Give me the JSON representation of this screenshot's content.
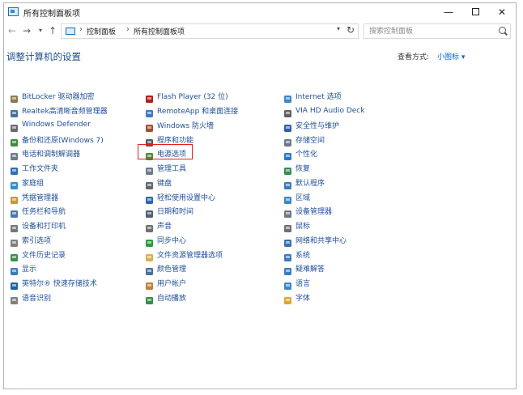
{
  "window": {
    "title": "所有控制面板项"
  },
  "address": {
    "crumbs": [
      "控制面板",
      "所有控制面板项"
    ]
  },
  "search": {
    "placeholder": "搜索控制面板"
  },
  "header": {
    "title": "调整计算机的设置",
    "view_by_label": "查看方式:",
    "view_by_value": "小图标 ▾"
  },
  "columns": [
    [
      {
        "label": "BitLocker 驱动器加密",
        "icon": "bitlocker-icon",
        "color": "#8a7a55"
      },
      {
        "label": "Realtek高清晰音频管理器",
        "icon": "realtek-icon",
        "color": "#4a6fa0"
      },
      {
        "label": "Windows Defender",
        "icon": "defender-icon",
        "color": "#6b6b6b"
      },
      {
        "label": "备份和还原(Windows 7)",
        "icon": "backup-icon",
        "color": "#3f8a3f"
      },
      {
        "label": "电话和调制解调器",
        "icon": "phone-modem-icon",
        "color": "#6b7b8b"
      },
      {
        "label": "工作文件夹",
        "icon": "work-folders-icon",
        "color": "#2f6fb5"
      },
      {
        "label": "家庭组",
        "icon": "homegroup-icon",
        "color": "#2f8fd0"
      },
      {
        "label": "凭据管理器",
        "icon": "credential-manager-icon",
        "color": "#c8963c"
      },
      {
        "label": "任务栏和导航",
        "icon": "taskbar-icon",
        "color": "#4a78b0"
      },
      {
        "label": "设备和打印机",
        "icon": "printer-icon",
        "color": "#707880"
      },
      {
        "label": "索引选项",
        "icon": "indexing-icon",
        "color": "#808080"
      },
      {
        "label": "文件历史记录",
        "icon": "file-history-icon",
        "color": "#3e8e4e"
      },
      {
        "label": "显示",
        "icon": "display-icon",
        "color": "#3a7cc0"
      },
      {
        "label": "英特尔® 快速存储技术",
        "icon": "intel-rst-icon",
        "color": "#2060a8"
      },
      {
        "label": "语音识别",
        "icon": "microphone-icon",
        "color": "#808080"
      }
    ],
    [
      {
        "label": "Flash Player (32 位)",
        "icon": "flash-icon",
        "color": "#b02020"
      },
      {
        "label": "RemoteApp 和桌面连接",
        "icon": "remoteapp-icon",
        "color": "#3a7cc0"
      },
      {
        "label": "Windows 防火墙",
        "icon": "firewall-icon",
        "color": "#a05030"
      },
      {
        "label": "程序和功能",
        "icon": "programs-icon",
        "color": "#505860"
      },
      {
        "label": "电源选项",
        "icon": "power-options-icon",
        "color": "#4a8a3a"
      },
      {
        "label": "管理工具",
        "icon": "admin-tools-icon",
        "color": "#6a7a8a"
      },
      {
        "label": "键盘",
        "icon": "keyboard-icon",
        "color": "#606870"
      },
      {
        "label": "轻松使用设置中心",
        "icon": "ease-of-access-icon",
        "color": "#3068b0"
      },
      {
        "label": "日期和时间",
        "icon": "clock-icon",
        "color": "#50606f"
      },
      {
        "label": "声音",
        "icon": "speaker-icon",
        "color": "#707070"
      },
      {
        "label": "同步中心",
        "icon": "sync-icon",
        "color": "#2f9a3f"
      },
      {
        "label": "文件资源管理器选项",
        "icon": "folder-options-icon",
        "color": "#d8b050"
      },
      {
        "label": "颜色管理",
        "icon": "color-management-icon",
        "color": "#4a70a0"
      },
      {
        "label": "用户帐户",
        "icon": "user-accounts-icon",
        "color": "#c08040"
      },
      {
        "label": "自动播放",
        "icon": "autoplay-icon",
        "color": "#3a8a4a"
      }
    ],
    [
      {
        "label": "Internet 选项",
        "icon": "internet-options-icon",
        "color": "#3a88c8"
      },
      {
        "label": "VIA HD Audio Deck",
        "icon": "via-audio-icon",
        "color": "#606060"
      },
      {
        "label": "安全性与维护",
        "icon": "flag-icon",
        "color": "#2f5fa8"
      },
      {
        "label": "存储空间",
        "icon": "storage-spaces-icon",
        "color": "#6a7a8a"
      },
      {
        "label": "个性化",
        "icon": "personalization-icon",
        "color": "#2f78c0"
      },
      {
        "label": "恢复",
        "icon": "recovery-icon",
        "color": "#3a8a5a"
      },
      {
        "label": "默认程序",
        "icon": "default-programs-icon",
        "color": "#3a7cc0"
      },
      {
        "label": "区域",
        "icon": "region-icon",
        "color": "#3a88c8"
      },
      {
        "label": "设备管理器",
        "icon": "device-manager-icon",
        "color": "#707880"
      },
      {
        "label": "鼠标",
        "icon": "mouse-icon",
        "color": "#707070"
      },
      {
        "label": "网络和共享中心",
        "icon": "network-icon",
        "color": "#3a70b0"
      },
      {
        "label": "系统",
        "icon": "system-icon",
        "color": "#3a7cc0"
      },
      {
        "label": "疑难解答",
        "icon": "troubleshooting-icon",
        "color": "#3a7cc0"
      },
      {
        "label": "语言",
        "icon": "language-icon",
        "color": "#3a88c8"
      },
      {
        "label": "字体",
        "icon": "fonts-icon",
        "color": "#d8a830"
      }
    ]
  ]
}
